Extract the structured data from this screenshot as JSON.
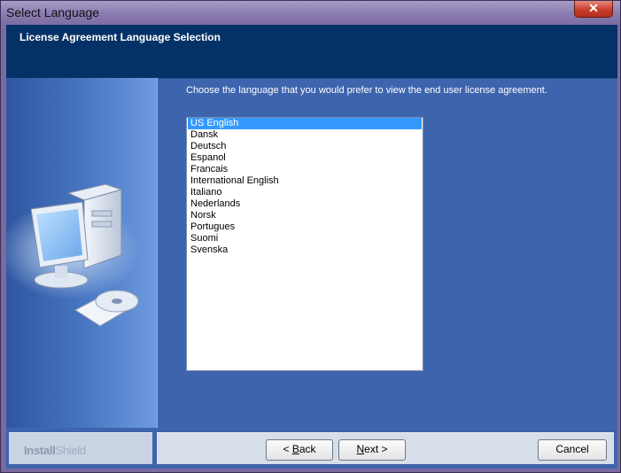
{
  "window": {
    "title": "Select Language",
    "close_glyph": "✕"
  },
  "header": {
    "title": "License Agreement Language Selection"
  },
  "prompt": "Choose the language that you would prefer to view the end user license agreement.",
  "languages": [
    "US English",
    "Dansk",
    "Deutsch",
    "Espanol",
    "Francais",
    "International English",
    "Italiano",
    "Nederlands",
    "Norsk",
    "Portugues",
    "Suomi",
    "Svenska"
  ],
  "selected_language": "US English",
  "brand": {
    "bold": "Install",
    "light": "Shield"
  },
  "buttons": {
    "back": {
      "prefix": "< ",
      "mnemonic": "B",
      "rest": "ack"
    },
    "next": {
      "mnemonic": "N",
      "rest": "ext >"
    },
    "cancel": "Cancel"
  },
  "colors": {
    "header_bg": "#053266",
    "client_bg": "#3e64ad",
    "selection": "#3399ff"
  },
  "icons": {
    "close": "close-icon",
    "computer": "computer-cd-icon"
  }
}
